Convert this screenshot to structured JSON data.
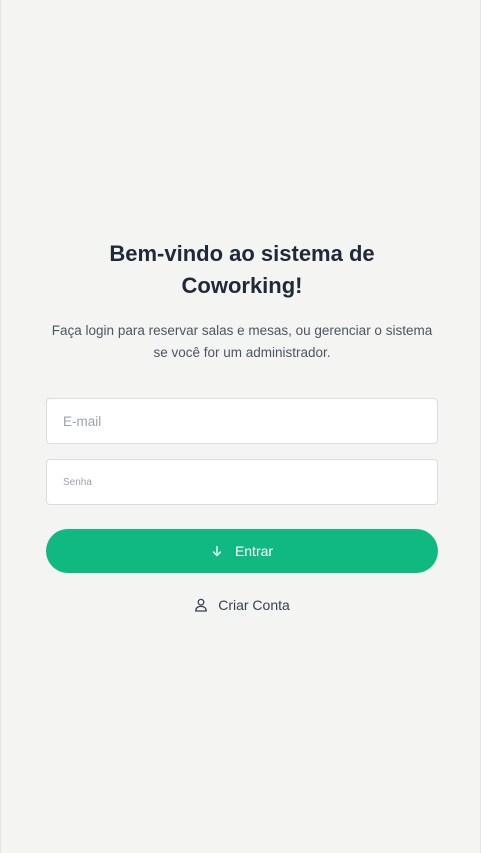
{
  "login": {
    "title": "Bem-vindo ao sistema de Coworking!",
    "subtitle": "Faça login para reservar salas e mesas, ou gerenciar o sistema se você for um administrador.",
    "email": {
      "value": "",
      "placeholder": "E-mail"
    },
    "password": {
      "value": "",
      "placeholder": "Senha"
    },
    "submit": {
      "label": "Entrar",
      "icon": "arrow-down-icon"
    },
    "create_account": {
      "label": "Criar Conta",
      "icon": "user-icon"
    }
  },
  "colors": {
    "background": "#f4f4f2",
    "primary": "#10b981",
    "title": "#1f2937",
    "text": "#4b5563"
  }
}
